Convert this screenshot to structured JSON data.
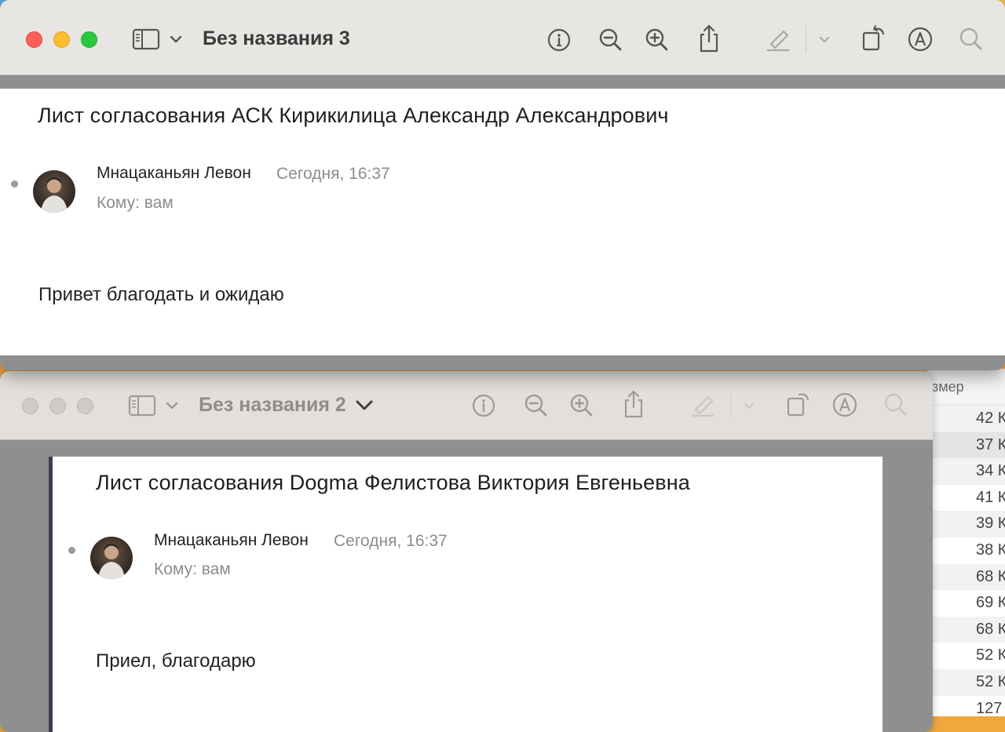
{
  "front_window": {
    "title": "Без названия 3",
    "document": {
      "heading": "Лист согласования АСК Кирикилица Александр Александрович",
      "sender": "Мнацаканьян Левон",
      "time": "Сегодня, 16:37",
      "to": "Кому: вам",
      "body": "Привет благодать и ожидаю"
    }
  },
  "back_window": {
    "title": "Без названия 2",
    "document": {
      "heading": "Лист согласования Dogma Фелистова Виктория Евгеньевна",
      "sender": "Мнацаканьян Левон",
      "time": "Сегодня, 16:37",
      "to": "Кому: вам",
      "body": "Приел, благодарю"
    }
  },
  "finder": {
    "column_header": "змер",
    "rows": [
      "42 К",
      "37 К",
      "34 К",
      "41 К",
      "39 К",
      "38 К",
      "68 К",
      "69 К",
      "68 К",
      "52 К",
      "52 К",
      "127 К"
    ]
  },
  "icons": {
    "sidebar": "sidebar-icon",
    "info": "info-icon",
    "zoom_out": "zoom-out-icon",
    "zoom_in": "zoom-in-icon",
    "share": "share-icon",
    "markup": "highlighter-icon",
    "rotate": "rotate-icon",
    "annotate": "markup-pen-icon",
    "search": "search-icon"
  }
}
